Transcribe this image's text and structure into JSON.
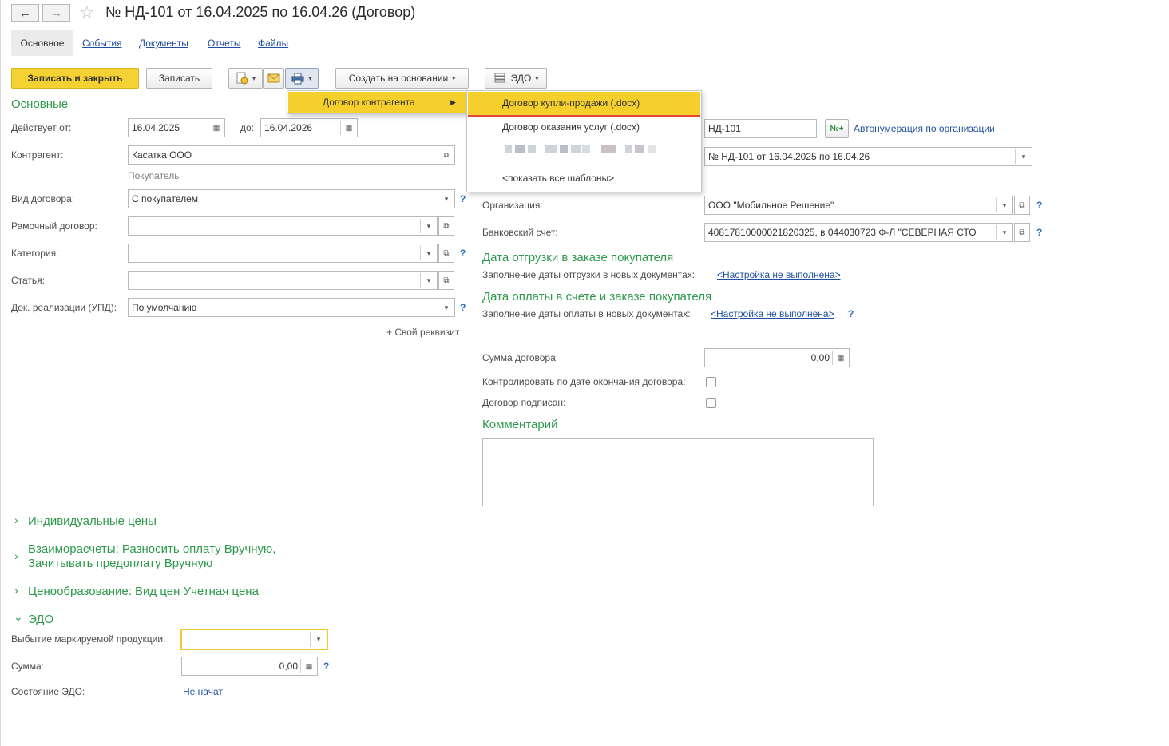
{
  "window": {
    "title": "№ НД-101 от 16.04.2025 по 16.04.26 (Договор)"
  },
  "tabs": [
    {
      "label": "Основное"
    },
    {
      "label": "События"
    },
    {
      "label": "Документы"
    },
    {
      "label": "Отчеты"
    },
    {
      "label": "Файлы"
    }
  ],
  "toolbar": {
    "save_close": "Записать и закрыть",
    "save": "Записать",
    "create_based": "Создать на основании",
    "edo": "ЭДО"
  },
  "menu": {
    "level1_item": "Договор контрагента",
    "level2_items": [
      {
        "label": "Договор купли-продажи (.docx)"
      },
      {
        "label": "Договор оказания услуг (.docx)"
      },
      {
        "label": "<показать все шаблоны>"
      }
    ]
  },
  "main": {
    "section_title": "Основные",
    "valid_from_label": "Действует от:",
    "valid_from": "16.04.2025",
    "to_label": "до:",
    "valid_to": "16.04.2026",
    "counterparty_label": "Контрагент:",
    "counterparty": "Касатка ООО",
    "counterparty_role": "Покупатель",
    "contract_kind_label": "Вид договора:",
    "contract_kind": "С покупателем",
    "framework_label": "Рамочный договор:",
    "category_label": "Категория:",
    "article_label": "Статья:",
    "upd_label": "Док. реализации (УПД):",
    "upd_value": "По умолчанию",
    "custom_attr": "+ Свой реквизит"
  },
  "right": {
    "number": "НД-101",
    "autonum_link": "Автонумерация по организации",
    "name": "№ НД-101 от 16.04.2025 по 16.04.26",
    "org_label": "Организация:",
    "org": "ООО \"Мобильное Решение\"",
    "bank_label": "Банковский счет:",
    "bank": "40817810000021820325, в 044030723 Ф-Л \"СЕВЕРНАЯ СТО",
    "ship_section": "Дата отгрузки в заказе покупателя",
    "ship_fill_label": "Заполнение даты отгрузки в новых документах:",
    "ship_fill_link": "<Настройка не выполнена>",
    "pay_section": "Дата оплаты в счете и заказе покупателя",
    "pay_fill_label": "Заполнение даты оплаты в новых документах:",
    "pay_fill_link": "<Настройка не выполнена>",
    "sum_label": "Сумма договора:",
    "sum": "0,00",
    "control_label": "Контролировать по дате окончания договора:",
    "signed_label": "Договор подписан:",
    "comment_section": "Комментарий"
  },
  "collapsibles": {
    "prices": "Индивидуальные цены",
    "settlements_line1": "Взаиморасчеты: Разносить оплату Вручную,",
    "settlements_line2": "Зачитывать предоплату Вручную",
    "pricing": "Ценообразование: Вид цен Учетная цена",
    "edo": "ЭДО"
  },
  "edo": {
    "marking_label": "Выбытие маркируемой продукции:",
    "sum_label": "Сумма:",
    "sum": "0,00",
    "state_label": "Состояние ЭДО:",
    "state": "Не начат"
  },
  "help": "?",
  "icons": {
    "back": "←",
    "forward": "→",
    "star": "☆",
    "calendar": "▦",
    "open": "⧉",
    "dropdown": "▾",
    "expand": "›",
    "collapse": "⌄",
    "submenu": "▶",
    "numbering": "№+"
  },
  "colors": {
    "accent_yellow": "#f5cf2b",
    "section_green": "#2d9a4b",
    "link_blue": "#2050a0",
    "underline_red": "#e3473a"
  }
}
